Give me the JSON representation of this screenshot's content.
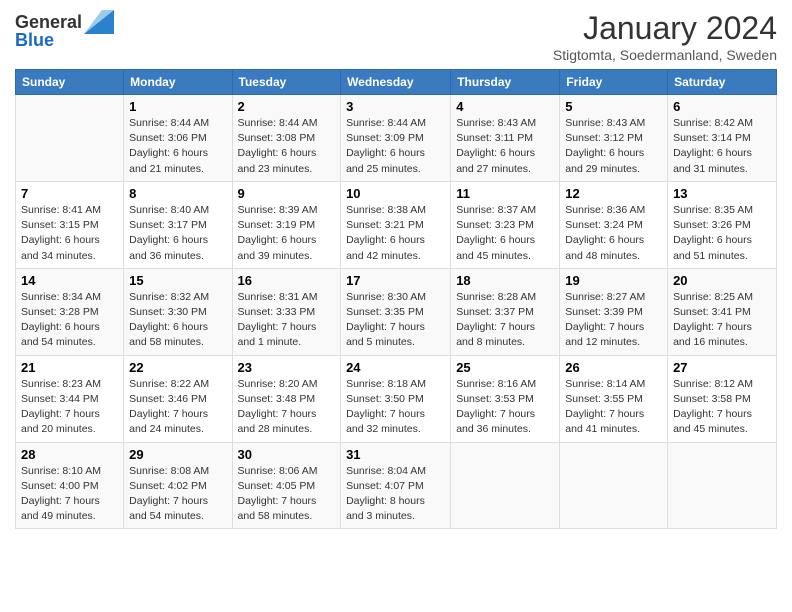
{
  "header": {
    "logo_general": "General",
    "logo_blue": "Blue",
    "title": "January 2024",
    "subtitle": "Stigtomta, Soedermanland, Sweden"
  },
  "days_of_week": [
    "Sunday",
    "Monday",
    "Tuesday",
    "Wednesday",
    "Thursday",
    "Friday",
    "Saturday"
  ],
  "weeks": [
    [
      {
        "day": "",
        "sunrise": "",
        "sunset": "",
        "daylight": ""
      },
      {
        "day": "1",
        "sunrise": "Sunrise: 8:44 AM",
        "sunset": "Sunset: 3:06 PM",
        "daylight": "Daylight: 6 hours and 21 minutes."
      },
      {
        "day": "2",
        "sunrise": "Sunrise: 8:44 AM",
        "sunset": "Sunset: 3:08 PM",
        "daylight": "Daylight: 6 hours and 23 minutes."
      },
      {
        "day": "3",
        "sunrise": "Sunrise: 8:44 AM",
        "sunset": "Sunset: 3:09 PM",
        "daylight": "Daylight: 6 hours and 25 minutes."
      },
      {
        "day": "4",
        "sunrise": "Sunrise: 8:43 AM",
        "sunset": "Sunset: 3:11 PM",
        "daylight": "Daylight: 6 hours and 27 minutes."
      },
      {
        "day": "5",
        "sunrise": "Sunrise: 8:43 AM",
        "sunset": "Sunset: 3:12 PM",
        "daylight": "Daylight: 6 hours and 29 minutes."
      },
      {
        "day": "6",
        "sunrise": "Sunrise: 8:42 AM",
        "sunset": "Sunset: 3:14 PM",
        "daylight": "Daylight: 6 hours and 31 minutes."
      }
    ],
    [
      {
        "day": "7",
        "sunrise": "Sunrise: 8:41 AM",
        "sunset": "Sunset: 3:15 PM",
        "daylight": "Daylight: 6 hours and 34 minutes."
      },
      {
        "day": "8",
        "sunrise": "Sunrise: 8:40 AM",
        "sunset": "Sunset: 3:17 PM",
        "daylight": "Daylight: 6 hours and 36 minutes."
      },
      {
        "day": "9",
        "sunrise": "Sunrise: 8:39 AM",
        "sunset": "Sunset: 3:19 PM",
        "daylight": "Daylight: 6 hours and 39 minutes."
      },
      {
        "day": "10",
        "sunrise": "Sunrise: 8:38 AM",
        "sunset": "Sunset: 3:21 PM",
        "daylight": "Daylight: 6 hours and 42 minutes."
      },
      {
        "day": "11",
        "sunrise": "Sunrise: 8:37 AM",
        "sunset": "Sunset: 3:23 PM",
        "daylight": "Daylight: 6 hours and 45 minutes."
      },
      {
        "day": "12",
        "sunrise": "Sunrise: 8:36 AM",
        "sunset": "Sunset: 3:24 PM",
        "daylight": "Daylight: 6 hours and 48 minutes."
      },
      {
        "day": "13",
        "sunrise": "Sunrise: 8:35 AM",
        "sunset": "Sunset: 3:26 PM",
        "daylight": "Daylight: 6 hours and 51 minutes."
      }
    ],
    [
      {
        "day": "14",
        "sunrise": "Sunrise: 8:34 AM",
        "sunset": "Sunset: 3:28 PM",
        "daylight": "Daylight: 6 hours and 54 minutes."
      },
      {
        "day": "15",
        "sunrise": "Sunrise: 8:32 AM",
        "sunset": "Sunset: 3:30 PM",
        "daylight": "Daylight: 6 hours and 58 minutes."
      },
      {
        "day": "16",
        "sunrise": "Sunrise: 8:31 AM",
        "sunset": "Sunset: 3:33 PM",
        "daylight": "Daylight: 7 hours and 1 minute."
      },
      {
        "day": "17",
        "sunrise": "Sunrise: 8:30 AM",
        "sunset": "Sunset: 3:35 PM",
        "daylight": "Daylight: 7 hours and 5 minutes."
      },
      {
        "day": "18",
        "sunrise": "Sunrise: 8:28 AM",
        "sunset": "Sunset: 3:37 PM",
        "daylight": "Daylight: 7 hours and 8 minutes."
      },
      {
        "day": "19",
        "sunrise": "Sunrise: 8:27 AM",
        "sunset": "Sunset: 3:39 PM",
        "daylight": "Daylight: 7 hours and 12 minutes."
      },
      {
        "day": "20",
        "sunrise": "Sunrise: 8:25 AM",
        "sunset": "Sunset: 3:41 PM",
        "daylight": "Daylight: 7 hours and 16 minutes."
      }
    ],
    [
      {
        "day": "21",
        "sunrise": "Sunrise: 8:23 AM",
        "sunset": "Sunset: 3:44 PM",
        "daylight": "Daylight: 7 hours and 20 minutes."
      },
      {
        "day": "22",
        "sunrise": "Sunrise: 8:22 AM",
        "sunset": "Sunset: 3:46 PM",
        "daylight": "Daylight: 7 hours and 24 minutes."
      },
      {
        "day": "23",
        "sunrise": "Sunrise: 8:20 AM",
        "sunset": "Sunset: 3:48 PM",
        "daylight": "Daylight: 7 hours and 28 minutes."
      },
      {
        "day": "24",
        "sunrise": "Sunrise: 8:18 AM",
        "sunset": "Sunset: 3:50 PM",
        "daylight": "Daylight: 7 hours and 32 minutes."
      },
      {
        "day": "25",
        "sunrise": "Sunrise: 8:16 AM",
        "sunset": "Sunset: 3:53 PM",
        "daylight": "Daylight: 7 hours and 36 minutes."
      },
      {
        "day": "26",
        "sunrise": "Sunrise: 8:14 AM",
        "sunset": "Sunset: 3:55 PM",
        "daylight": "Daylight: 7 hours and 41 minutes."
      },
      {
        "day": "27",
        "sunrise": "Sunrise: 8:12 AM",
        "sunset": "Sunset: 3:58 PM",
        "daylight": "Daylight: 7 hours and 45 minutes."
      }
    ],
    [
      {
        "day": "28",
        "sunrise": "Sunrise: 8:10 AM",
        "sunset": "Sunset: 4:00 PM",
        "daylight": "Daylight: 7 hours and 49 minutes."
      },
      {
        "day": "29",
        "sunrise": "Sunrise: 8:08 AM",
        "sunset": "Sunset: 4:02 PM",
        "daylight": "Daylight: 7 hours and 54 minutes."
      },
      {
        "day": "30",
        "sunrise": "Sunrise: 8:06 AM",
        "sunset": "Sunset: 4:05 PM",
        "daylight": "Daylight: 7 hours and 58 minutes."
      },
      {
        "day": "31",
        "sunrise": "Sunrise: 8:04 AM",
        "sunset": "Sunset: 4:07 PM",
        "daylight": "Daylight: 8 hours and 3 minutes."
      },
      {
        "day": "",
        "sunrise": "",
        "sunset": "",
        "daylight": ""
      },
      {
        "day": "",
        "sunrise": "",
        "sunset": "",
        "daylight": ""
      },
      {
        "day": "",
        "sunrise": "",
        "sunset": "",
        "daylight": ""
      }
    ]
  ]
}
